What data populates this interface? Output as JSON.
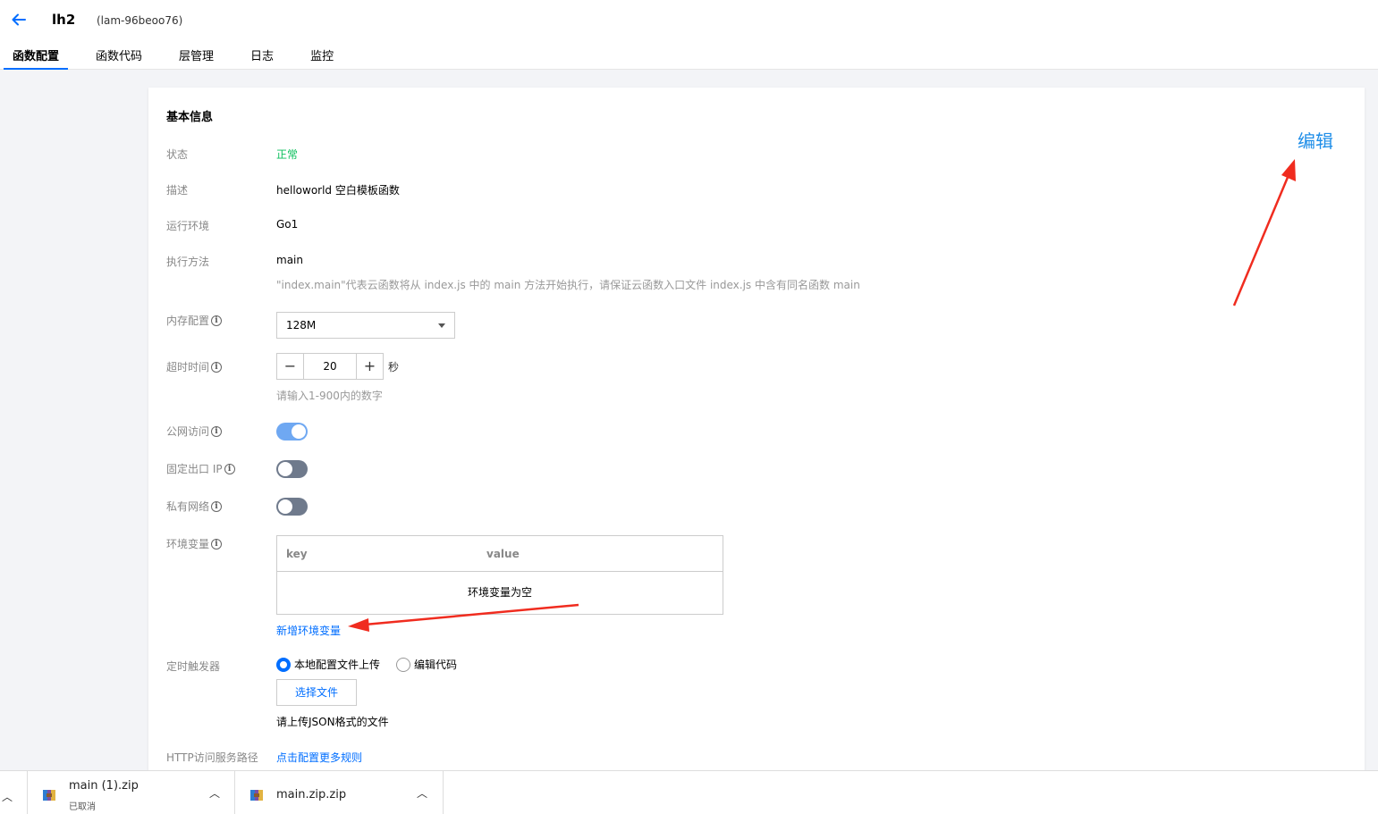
{
  "header": {
    "function_name": "lh2",
    "function_id": "(lam-96beoo76)",
    "tabs": [
      {
        "label": "函数配置",
        "active": true
      },
      {
        "label": "函数代码",
        "active": false
      },
      {
        "label": "层管理",
        "active": false
      },
      {
        "label": "日志",
        "active": false
      },
      {
        "label": "监控",
        "active": false
      }
    ]
  },
  "basic_info": {
    "title": "基本信息",
    "edit_label": "编辑",
    "status": {
      "label": "状态",
      "value": "正常"
    },
    "description": {
      "label": "描述",
      "value": "helloworld 空白模板函数"
    },
    "runtime": {
      "label": "运行环境",
      "value": "Go1"
    },
    "handler": {
      "label": "执行方法",
      "value": "main",
      "hint": "\"index.main\"代表云函数将从 index.js 中的 main 方法开始执行，请保证云函数入口文件 index.js 中含有同名函数 main"
    },
    "memory": {
      "label": "内存配置",
      "value": "128M"
    },
    "timeout": {
      "label": "超时时间",
      "value": "20",
      "unit": "秒",
      "hint": "请输入1-900内的数字"
    },
    "public_access": {
      "label": "公网访问",
      "enabled": true
    },
    "fixed_ip": {
      "label": "固定出口 IP",
      "enabled": false
    },
    "private_network": {
      "label": "私有网络",
      "enabled": false
    },
    "env_vars": {
      "label": "环境变量",
      "col_key": "key",
      "col_value": "value",
      "empty_text": "环境变量为空",
      "add_label": "新增环境变量"
    },
    "timer_trigger": {
      "label": "定时触发器",
      "option_upload": "本地配置文件上传",
      "option_edit": "编辑代码",
      "selected": "option_upload",
      "file_button": "选择文件",
      "hint": "请上传JSON格式的文件"
    },
    "http_path": {
      "label": "HTTP访问服务路径",
      "link": "点击配置更多规则"
    }
  },
  "downloads": [
    {
      "name": "main (1).zip",
      "status": "已取消"
    },
    {
      "name": "main.zip.zip",
      "status": ""
    }
  ],
  "colors": {
    "accent": "#006eff",
    "ok_green": "#0abf5b",
    "annotation_red": "#f02c1f"
  }
}
